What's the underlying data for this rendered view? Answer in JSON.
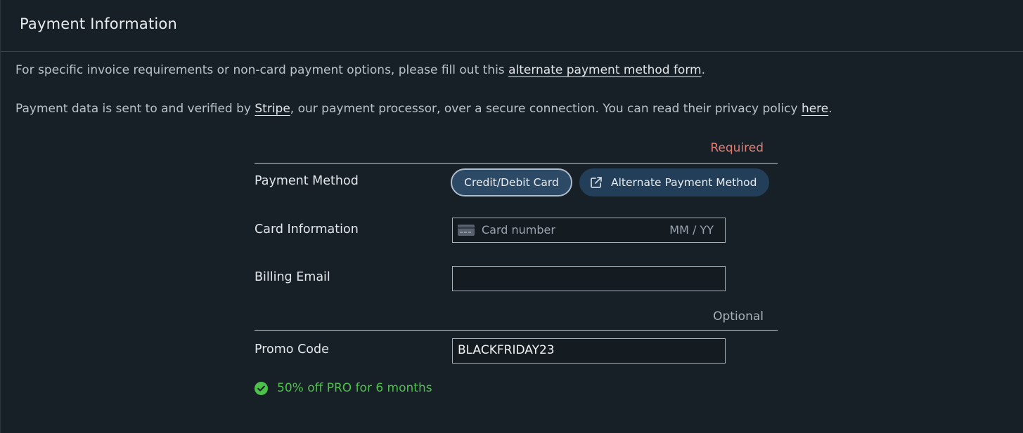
{
  "header": {
    "title": "Payment Information"
  },
  "intro": {
    "p1_before": "For specific invoice requirements or non-card payment options, please fill out this ",
    "p1_link": "alternate payment method form",
    "p1_after": ".",
    "p2_before": "Payment data is sent to and verified by ",
    "p2_link1": "Stripe",
    "p2_middle": ", our payment processor, over a secure connection. You can read their privacy policy ",
    "p2_link2": "here",
    "p2_after": "."
  },
  "sections": {
    "required_label": "Required",
    "optional_label": "Optional"
  },
  "payment_method": {
    "label": "Payment Method",
    "options": [
      {
        "label": "Credit/Debit Card",
        "selected": true,
        "icon": null
      },
      {
        "label": "Alternate Payment Method",
        "selected": false,
        "icon": "external-link-icon"
      }
    ]
  },
  "card_information": {
    "label": "Card Information",
    "number_placeholder": "Card number",
    "expiry_placeholder": "MM / YY",
    "icon": "credit-card-icon"
  },
  "billing_email": {
    "label": "Billing Email",
    "value": ""
  },
  "promo_code": {
    "label": "Promo Code",
    "value": "BLACKFRIDAY23",
    "status_icon": "check-circle-icon",
    "status_text": "50% off PRO for 6 months"
  },
  "colors": {
    "background": "#182027",
    "required": "#e07b73",
    "success": "#4cc24a",
    "selected_button": "#2c4a66",
    "button": "#233e58"
  }
}
